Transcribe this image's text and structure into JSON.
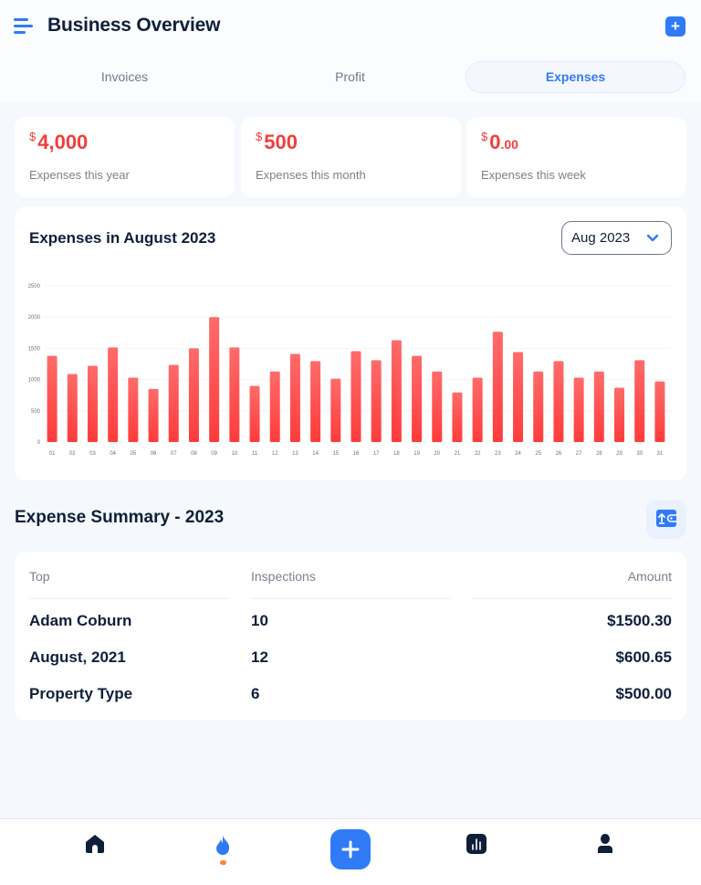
{
  "header": {
    "title": "Business Overview",
    "menu_icon": "hamburger-menu-icon",
    "add_icon": "plus-icon"
  },
  "tabs": [
    {
      "label": "Invoices",
      "active": false
    },
    {
      "label": "Profit",
      "active": false
    },
    {
      "label": "Expenses",
      "active": true
    }
  ],
  "stats": [
    {
      "currency": "$",
      "value": "4,000",
      "decimals": "",
      "label": "Expenses this year"
    },
    {
      "currency": "$",
      "value": "500",
      "decimals": "",
      "label": "Expenses this month"
    },
    {
      "currency": "$",
      "value": "0",
      "decimals": ".00",
      "label": "Expenses this week"
    }
  ],
  "chart_section": {
    "title": "Expenses in August 2023",
    "selected_month": "Aug 2023",
    "dropdown_icon": "chevron-down-icon"
  },
  "chart_data": {
    "type": "bar",
    "title": "Expenses in August 2023",
    "xlabel": "",
    "ylabel": "",
    "ylim": [
      0,
      2500
    ],
    "yticks": [
      0,
      500,
      1000,
      1500,
      2000,
      2500
    ],
    "grid": true,
    "categories": [
      "01",
      "02",
      "03",
      "04",
      "05",
      "06",
      "07",
      "08",
      "09",
      "10",
      "11",
      "12",
      "13",
      "14",
      "15",
      "16",
      "17",
      "18",
      "19",
      "20",
      "21",
      "22",
      "23",
      "24",
      "25",
      "26",
      "27",
      "28",
      "29",
      "30",
      "31"
    ],
    "values": [
      1380,
      1090,
      1220,
      1515,
      1030,
      850,
      1235,
      1500,
      2000,
      1515,
      900,
      1130,
      1410,
      1295,
      1015,
      1455,
      1310,
      1630,
      1380,
      1130,
      795,
      1030,
      1765,
      1440,
      1130,
      1295,
      1030,
      1130,
      870,
      1310,
      970
    ],
    "color_top": "#ff6b6b",
    "color_bottom": "#ff3b3b"
  },
  "summary": {
    "title": "Expense Summary - 2023",
    "export_icon": "export-wallet-icon",
    "columns": [
      "Top",
      "Inspections",
      "Amount"
    ],
    "rows": [
      {
        "top": "Adam Coburn",
        "inspections": "10",
        "amount": "$1500.30"
      },
      {
        "top": "August, 2021",
        "inspections": "12",
        "amount": "$600.65"
      },
      {
        "top": "Property Type",
        "inspections": "6",
        "amount": "$500.00"
      }
    ]
  },
  "bottom_nav": {
    "items": [
      {
        "icon": "home-icon",
        "active": false
      },
      {
        "icon": "flame-icon",
        "active": true
      },
      {
        "icon": "plus-icon",
        "active": false
      },
      {
        "icon": "bar-chart-icon",
        "active": false
      },
      {
        "icon": "user-icon",
        "active": false
      }
    ],
    "accent": "#2f7bf5",
    "indicator": "#f58a3a"
  }
}
